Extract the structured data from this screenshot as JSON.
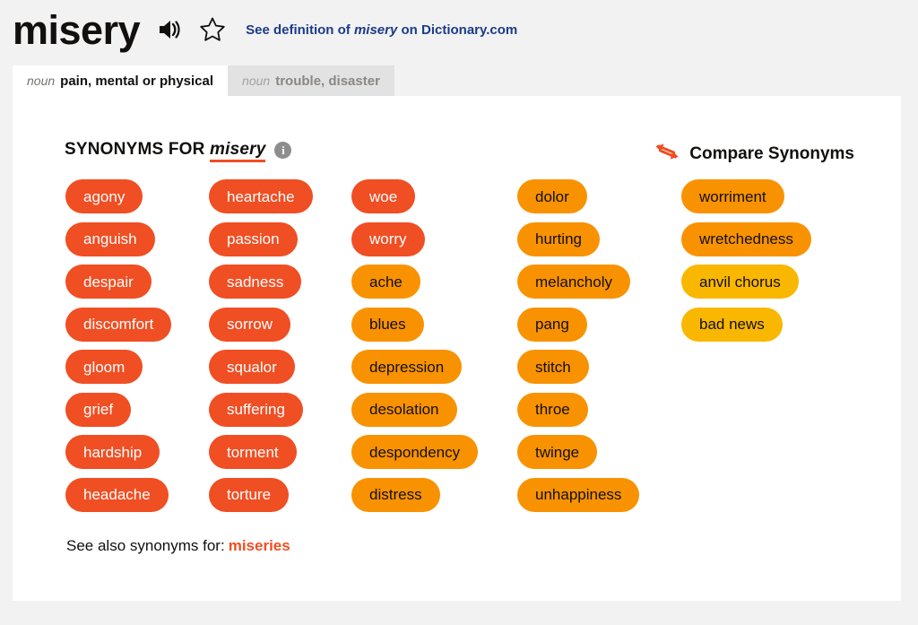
{
  "header": {
    "word": "misery",
    "speaker_icon": "speaker-audio-icon",
    "star_icon": "star-outline-icon",
    "definition_link_prefix": "See definition of",
    "definition_link_word": "misery",
    "definition_link_suffix": "on Dictionary.com"
  },
  "tabs": [
    {
      "pos": "noun",
      "label": "pain, mental or physical",
      "active": true
    },
    {
      "pos": "noun",
      "label": "trouble, disaster",
      "active": false
    }
  ],
  "section": {
    "title_prefix": "SYNONYMS FOR",
    "target_word": "misery",
    "info_icon": "info-circle-icon",
    "info_glyph": "i",
    "compare_icon": "compare-arrows-icon",
    "compare_label": "Compare Synonyms"
  },
  "colors": {
    "strong_red": "#f04e23",
    "medium_orange": "#f99200",
    "light_gold": "#fab700",
    "page_background": "#f2f2f2",
    "card_background": "#ffffff",
    "link_blue": "#1b3c87",
    "tab_inactive_background": "#e2e2e2"
  },
  "columns": [
    {
      "index": 1,
      "items": [
        {
          "text": "agony",
          "strength": 3
        },
        {
          "text": "anguish",
          "strength": 3
        },
        {
          "text": "despair",
          "strength": 3
        },
        {
          "text": "discomfort",
          "strength": 3
        },
        {
          "text": "gloom",
          "strength": 3
        },
        {
          "text": "grief",
          "strength": 3
        },
        {
          "text": "hardship",
          "strength": 3
        },
        {
          "text": "headache",
          "strength": 3
        }
      ]
    },
    {
      "index": 2,
      "items": [
        {
          "text": "heartache",
          "strength": 3
        },
        {
          "text": "passion",
          "strength": 3
        },
        {
          "text": "sadness",
          "strength": 3
        },
        {
          "text": "sorrow",
          "strength": 3
        },
        {
          "text": "squalor",
          "strength": 3
        },
        {
          "text": "suffering",
          "strength": 3
        },
        {
          "text": "torment",
          "strength": 3
        },
        {
          "text": "torture",
          "strength": 3
        }
      ]
    },
    {
      "index": 3,
      "items": [
        {
          "text": "woe",
          "strength": 3
        },
        {
          "text": "worry",
          "strength": 3
        },
        {
          "text": "ache",
          "strength": 2
        },
        {
          "text": "blues",
          "strength": 2
        },
        {
          "text": "depression",
          "strength": 2
        },
        {
          "text": "desolation",
          "strength": 2
        },
        {
          "text": "despondency",
          "strength": 2
        },
        {
          "text": "distress",
          "strength": 2
        }
      ]
    },
    {
      "index": 4,
      "items": [
        {
          "text": "dolor",
          "strength": 2
        },
        {
          "text": "hurting",
          "strength": 2
        },
        {
          "text": "melancholy",
          "strength": 2
        },
        {
          "text": "pang",
          "strength": 2
        },
        {
          "text": "stitch",
          "strength": 2
        },
        {
          "text": "throe",
          "strength": 2
        },
        {
          "text": "twinge",
          "strength": 2
        },
        {
          "text": "unhappiness",
          "strength": 2
        }
      ]
    },
    {
      "index": 5,
      "items": [
        {
          "text": "worriment",
          "strength": 2
        },
        {
          "text": "wretchedness",
          "strength": 2
        },
        {
          "text": "anvil chorus",
          "strength": 1
        },
        {
          "text": "bad news",
          "strength": 1
        }
      ]
    }
  ],
  "footer": {
    "see_also_label": "See also synonyms for:",
    "see_also_link": "miseries"
  }
}
